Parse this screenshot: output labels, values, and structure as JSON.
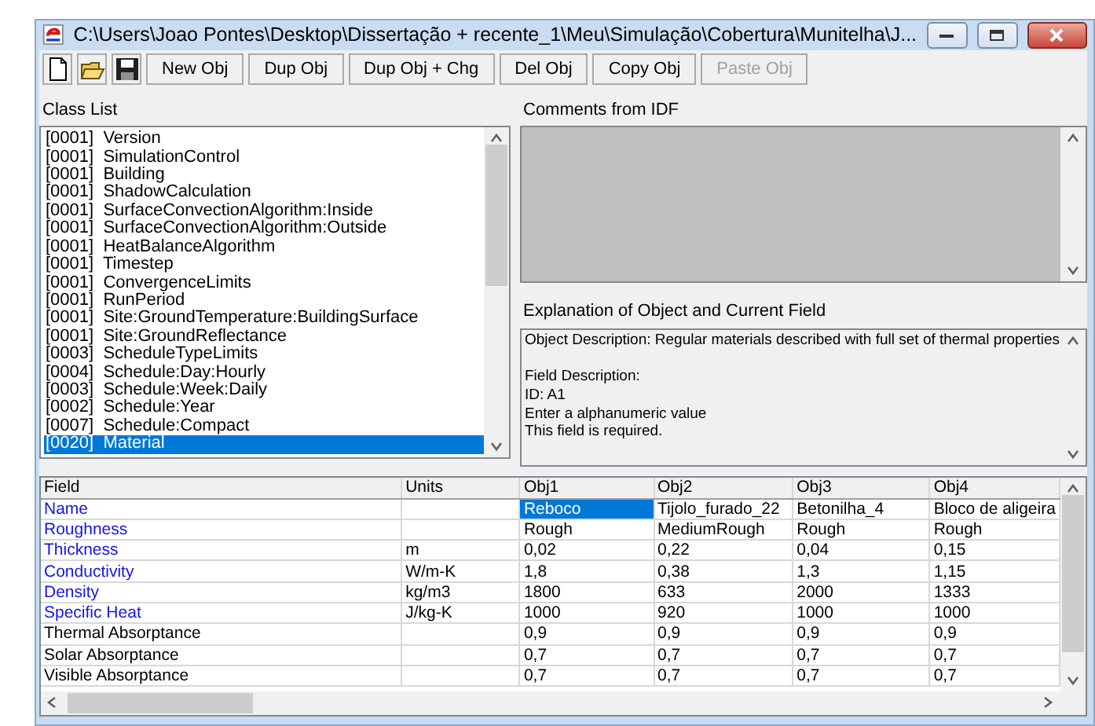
{
  "window": {
    "title": "C:\\Users\\Joao Pontes\\Desktop\\Dissertação + recente_1\\Meu\\Simulação\\Cobertura\\Munitelha\\J..."
  },
  "toolbar": {
    "icon_buttons": [
      {
        "kind": "new"
      },
      {
        "kind": "open"
      },
      {
        "kind": "save"
      }
    ],
    "buttons": [
      {
        "label": "New Obj",
        "disabled": false
      },
      {
        "label": "Dup Obj",
        "disabled": false
      },
      {
        "label": "Dup Obj + Chg",
        "disabled": false
      },
      {
        "label": "Del Obj",
        "disabled": false
      },
      {
        "label": "Copy Obj",
        "disabled": false
      },
      {
        "label": "Paste Obj",
        "disabled": true
      }
    ]
  },
  "class_list": {
    "label": "Class List",
    "items": [
      {
        "label": "[0001]  Version",
        "selected": false
      },
      {
        "label": "[0001]  SimulationControl",
        "selected": false
      },
      {
        "label": "[0001]  Building",
        "selected": false
      },
      {
        "label": "[0001]  ShadowCalculation",
        "selected": false
      },
      {
        "label": "[0001]  SurfaceConvectionAlgorithm:Inside",
        "selected": false
      },
      {
        "label": "[0001]  SurfaceConvectionAlgorithm:Outside",
        "selected": false
      },
      {
        "label": "[0001]  HeatBalanceAlgorithm",
        "selected": false
      },
      {
        "label": "[0001]  Timestep",
        "selected": false
      },
      {
        "label": "[0001]  ConvergenceLimits",
        "selected": false
      },
      {
        "label": "[0001]  RunPeriod",
        "selected": false
      },
      {
        "label": "[0001]  Site:GroundTemperature:BuildingSurface",
        "selected": false
      },
      {
        "label": "[0001]  Site:GroundReflectance",
        "selected": false
      },
      {
        "label": "[0003]  ScheduleTypeLimits",
        "selected": false
      },
      {
        "label": "[0004]  Schedule:Day:Hourly",
        "selected": false
      },
      {
        "label": "[0003]  Schedule:Week:Daily",
        "selected": false
      },
      {
        "label": "[0002]  Schedule:Year",
        "selected": false
      },
      {
        "label": "[0007]  Schedule:Compact",
        "selected": false
      },
      {
        "label": "[0020]  Material",
        "selected": true
      }
    ]
  },
  "comments": {
    "label": "Comments from IDF"
  },
  "explanation": {
    "label": "Explanation of Object and Current Field",
    "lines": [
      "Object Description: Regular materials described with full set of thermal properties",
      "Field Description:",
      "ID: A1",
      "Enter a alphanumeric value",
      "This field is required."
    ]
  },
  "grid": {
    "columns": [
      "Field",
      "Units",
      "Obj1",
      "Obj2",
      "Obj3",
      "Obj4"
    ],
    "rows": [
      {
        "field": "Name",
        "required": true,
        "units": "",
        "values": [
          {
            "text": "Reboco",
            "selected": true
          },
          {
            "text": "Tijolo_furado_22",
            "selected": false
          },
          {
            "text": "Betonilha_4",
            "selected": false
          },
          {
            "text": "Bloco de aligeira",
            "selected": false
          }
        ]
      },
      {
        "field": "Roughness",
        "required": true,
        "units": "",
        "values": [
          {
            "text": "Rough",
            "selected": false
          },
          {
            "text": "MediumRough",
            "selected": false
          },
          {
            "text": "Rough",
            "selected": false
          },
          {
            "text": "Rough",
            "selected": false
          }
        ]
      },
      {
        "field": "Thickness",
        "required": true,
        "units": "m",
        "values": [
          {
            "text": "0,02",
            "selected": false
          },
          {
            "text": "0,22",
            "selected": false
          },
          {
            "text": "0,04",
            "selected": false
          },
          {
            "text": "0,15",
            "selected": false
          }
        ]
      },
      {
        "field": "Conductivity",
        "required": true,
        "units": "W/m-K",
        "values": [
          {
            "text": "1,8",
            "selected": false
          },
          {
            "text": "0,38",
            "selected": false
          },
          {
            "text": "1,3",
            "selected": false
          },
          {
            "text": "1,15",
            "selected": false
          }
        ]
      },
      {
        "field": "Density",
        "required": true,
        "units": "kg/m3",
        "values": [
          {
            "text": "1800",
            "selected": false
          },
          {
            "text": "633",
            "selected": false
          },
          {
            "text": "2000",
            "selected": false
          },
          {
            "text": "1333",
            "selected": false
          }
        ]
      },
      {
        "field": "Specific Heat",
        "required": true,
        "units": "J/kg-K",
        "values": [
          {
            "text": "1000",
            "selected": false
          },
          {
            "text": "920",
            "selected": false
          },
          {
            "text": "1000",
            "selected": false
          },
          {
            "text": "1000",
            "selected": false
          }
        ]
      },
      {
        "field": "Thermal Absorptance",
        "required": false,
        "units": "",
        "values": [
          {
            "text": "0,9",
            "selected": false
          },
          {
            "text": "0,9",
            "selected": false
          },
          {
            "text": "0,9",
            "selected": false
          },
          {
            "text": "0,9",
            "selected": false
          }
        ]
      },
      {
        "field": "Solar Absorptance",
        "required": false,
        "units": "",
        "values": [
          {
            "text": "0,7",
            "selected": false
          },
          {
            "text": "0,7",
            "selected": false
          },
          {
            "text": "0,7",
            "selected": false
          },
          {
            "text": "0,7",
            "selected": false
          }
        ]
      },
      {
        "field": "Visible Absorptance",
        "required": false,
        "units": "",
        "values": [
          {
            "text": "0,7",
            "selected": false
          },
          {
            "text": "0,7",
            "selected": false
          },
          {
            "text": "0,7",
            "selected": false
          },
          {
            "text": "0,7",
            "selected": false
          }
        ]
      }
    ]
  }
}
